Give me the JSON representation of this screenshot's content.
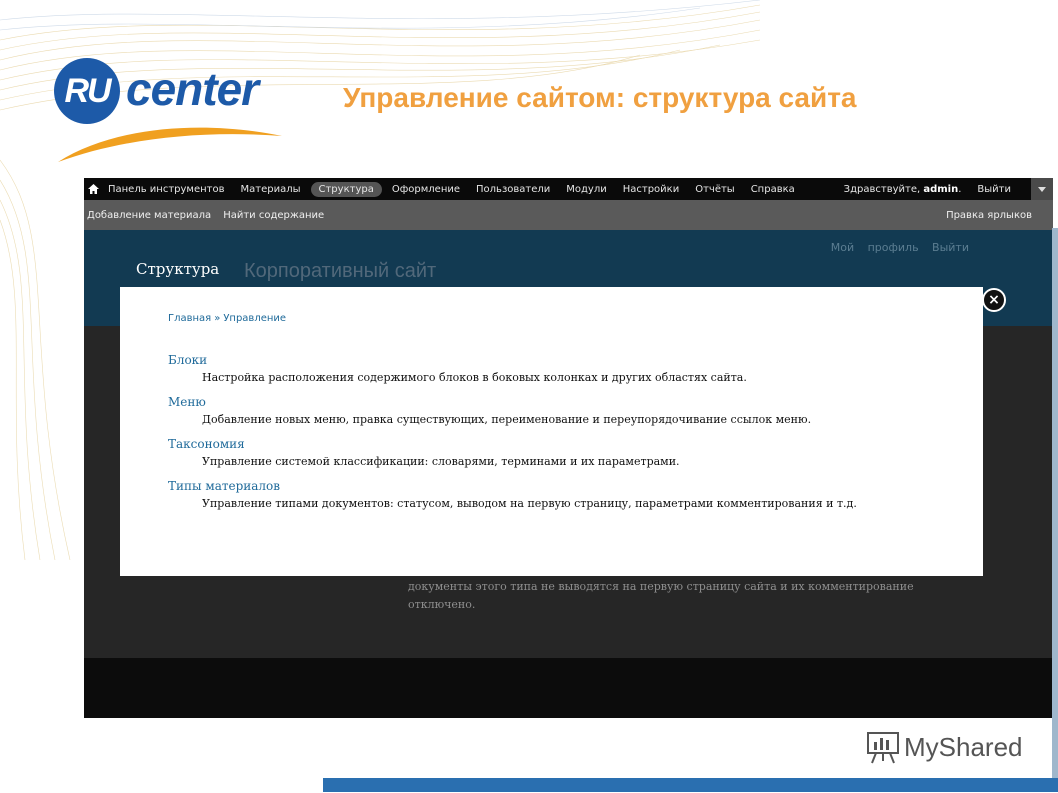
{
  "slide": {
    "title": "Управление сайтом: структура сайта",
    "logo": {
      "circle_letters": "RU",
      "text": "center",
      "colors": {
        "blue": "#1d5aa8",
        "orange": "#f0a020"
      }
    }
  },
  "toolbar": {
    "home_icon": "home-icon",
    "items": [
      "Панель инструментов",
      "Материалы",
      "Структура",
      "Оформление",
      "Пользователи",
      "Модули",
      "Настройки",
      "Отчёты",
      "Справка"
    ],
    "active": "Структура",
    "greeting": "Здравствуйте,",
    "username": "admin",
    "logout": "Выйти"
  },
  "shortcuts": {
    "items": [
      "Добавление материала",
      "Найти содержание"
    ],
    "edit": "Правка ярлыков"
  },
  "site": {
    "profile_links": "Мой профиль Выйти",
    "overlay_title": "Структура",
    "site_name": "Корпоративный сайт",
    "background_text": "документы этого типа не выводятся на первую страницу сайта и их комментирование отключено."
  },
  "overlay": {
    "breadcrumb": [
      "Главная",
      "Управление"
    ],
    "items": [
      {
        "label": "Блоки",
        "description": "Настройка расположения содержимого блоков в боковых колонках и других областях сайта."
      },
      {
        "label": "Меню",
        "description": "Добавление новых меню, правка существующих, переименование и переупорядочивание ссылок меню."
      },
      {
        "label": "Таксономия",
        "description": "Управление системой классификации: словарями, терминами и их параметрами."
      },
      {
        "label": "Типы материалов",
        "description": "Управление типами документов: статусом, выводом на первую страницу, параметрами комментирования и т.д."
      }
    ]
  },
  "watermark": {
    "text": "MyShared"
  },
  "colors": {
    "title_orange": "#f0a040",
    "link": "#1f6a9a",
    "header": "#123a52"
  }
}
